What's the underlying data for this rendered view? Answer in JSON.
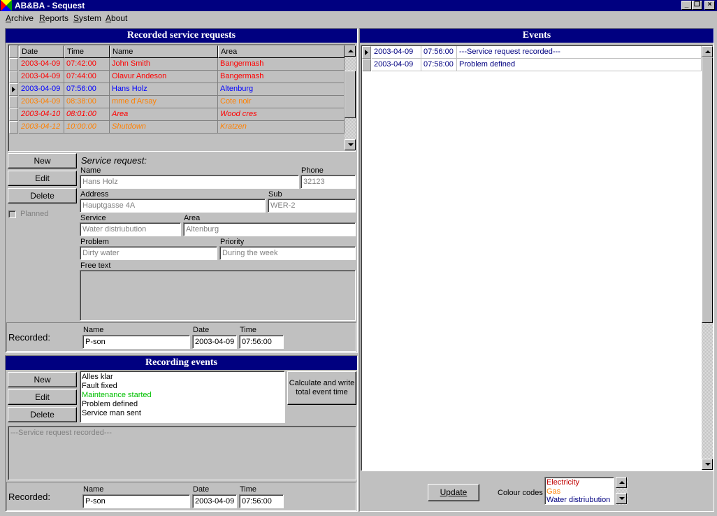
{
  "window": {
    "title": "AB&BA - Sequest"
  },
  "menu": [
    "Archive",
    "Reports",
    "System",
    "About"
  ],
  "colors": {
    "title_bar": "#000080",
    "red": "#ff0000",
    "blue": "#0000ff",
    "orange": "#ff8000",
    "green": "#00c000"
  },
  "service_requests": {
    "header": "Recorded service requests",
    "columns": [
      "Date",
      "Time",
      "Name",
      "Area"
    ],
    "rows": [
      {
        "date": "2003-04-09",
        "time": "07:42:00",
        "name": "John Smith",
        "area": "Bangermash",
        "color": "#ff0000",
        "italic": false
      },
      {
        "date": "2003-04-09",
        "time": "07:44:00",
        "name": "Olavur Andeson",
        "area": "Bangermash",
        "color": "#ff0000",
        "italic": false
      },
      {
        "date": "2003-04-09",
        "time": "07:56:00",
        "name": "Hans Holz",
        "area": "Altenburg",
        "color": "#0000ff",
        "italic": false
      },
      {
        "date": "2003-04-09",
        "time": "08:38:00",
        "name": "mme d'Arsay",
        "area": "Cote noir",
        "color": "#ff8000",
        "italic": false
      },
      {
        "date": "2003-04-10",
        "time": "08:01:00",
        "name": "Area",
        "area": "Wood cres",
        "color": "#ff0000",
        "italic": true
      },
      {
        "date": "2003-04-12",
        "time": "10:00:00",
        "name": "Shutdown",
        "area": "Kratzen",
        "color": "#ff8000",
        "italic": true
      }
    ]
  },
  "buttons": {
    "new": "New",
    "edit": "Edit",
    "delete": "Delete",
    "planned": "Planned",
    "calculate": "Calculate and write total event time",
    "update": "Update"
  },
  "form": {
    "section_title": "Service request:",
    "name_label": "Name",
    "name_value": "Hans Holz",
    "phone_label": "Phone",
    "phone_value": "32123",
    "address_label": "Address",
    "address_value": "Hauptgasse 4A",
    "sub_label": "Sub",
    "sub_value": "WER-2",
    "service_label": "Service",
    "service_value": "Water distriubution",
    "area_label": "Area",
    "area_value": "Altenburg",
    "problem_label": "Problem",
    "problem_value": "Dirty water",
    "priority_label": "Priority",
    "priority_value": "During the week",
    "free_text_label": "Free text",
    "free_text_value": ""
  },
  "recorded_top": {
    "label": "Recorded:",
    "name_label": "Name",
    "name_value": "P-son",
    "date_label": "Date",
    "date_value": "2003-04-09",
    "time_label": "Time",
    "time_value": "07:56:00"
  },
  "recording_events": {
    "header": "Recording events",
    "items": [
      {
        "text": "Alles klar",
        "color": "#000000"
      },
      {
        "text": "Fault fixed",
        "color": "#000000"
      },
      {
        "text": "Maintenance started",
        "color": "#00c000"
      },
      {
        "text": "Problem defined",
        "color": "#000000"
      },
      {
        "text": "Service man sent",
        "color": "#000000"
      }
    ],
    "memo_text": "---Service request recorded---"
  },
  "recorded_bottom": {
    "label": "Recorded:",
    "name_label": "Name",
    "name_value": "P-son",
    "date_label": "Date",
    "date_value": "2003-04-09",
    "time_label": "Time",
    "time_value": "07:56:00"
  },
  "events": {
    "header": "Events",
    "rows": [
      {
        "date": "2003-04-09",
        "time": "07:56:00",
        "desc": "---Service request recorded---"
      },
      {
        "date": "2003-04-09",
        "time": "07:58:00",
        "desc": "Problem defined"
      }
    ]
  },
  "colour_codes": {
    "label": "Colour codes",
    "items": [
      {
        "text": "Electricity",
        "color": "#c00000"
      },
      {
        "text": "Gas",
        "color": "#ff8000"
      },
      {
        "text": "Water distriubution",
        "color": "#000080"
      }
    ]
  }
}
